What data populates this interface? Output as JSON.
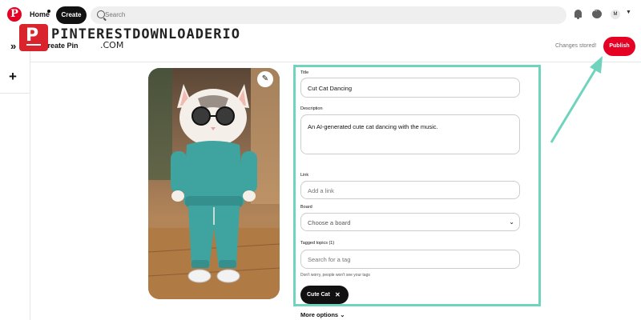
{
  "topnav": {
    "home_label": "Home",
    "create_label": "Create",
    "search_placeholder": "Search",
    "avatar_initial": "M"
  },
  "header": {
    "page_title": "Create Pin",
    "status_text": "Changes stored!",
    "publish_label": "Publish"
  },
  "watermark": {
    "line1": "PINTERESTDOWNLOADERIO",
    "line2": ".COM"
  },
  "form": {
    "title": {
      "label": "Title",
      "value": "Cut Cat Dancing"
    },
    "description": {
      "label": "Description",
      "value": "An AI-generated cute cat dancing with the music."
    },
    "link": {
      "label": "Link",
      "placeholder": "Add a link"
    },
    "board": {
      "label": "Board",
      "placeholder": "Choose a board"
    },
    "tags": {
      "label": "Tagged topics (1)",
      "placeholder": "Search for a tag",
      "hint": "Don't worry, people won't see your tags",
      "chips": [
        "Cute Cat"
      ]
    },
    "more_options_label": "More options"
  },
  "colors": {
    "brand_red": "#e60023",
    "highlight_frame": "#6fd3be",
    "dark": "#111111"
  }
}
